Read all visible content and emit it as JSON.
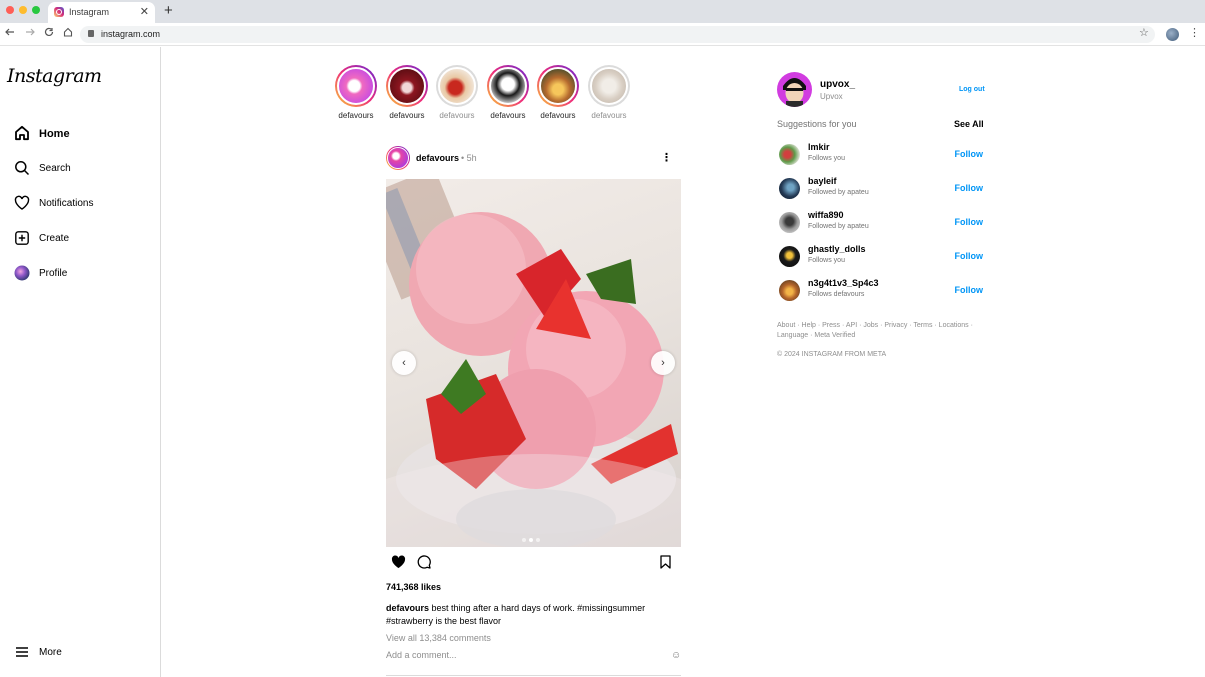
{
  "browser": {
    "tab_title": "Instagram",
    "tab_close": "✕",
    "new_tab": "+",
    "url": "instagram.com",
    "icons": [
      "back-icon",
      "forward-icon",
      "reload-icon",
      "home-icon",
      "lock-icon",
      "star-icon",
      "profile-avatar",
      "menu-icon"
    ]
  },
  "sidebar": {
    "logo": "Instagram",
    "items": [
      {
        "label": "Home",
        "icon": "home-icon",
        "active": true
      },
      {
        "label": "Search",
        "icon": "search-icon"
      },
      {
        "label": "Notifications",
        "icon": "heart-icon"
      },
      {
        "label": "Create",
        "icon": "plus-square-icon"
      },
      {
        "label": "Profile",
        "icon": "profile-avatar"
      }
    ],
    "more_label": "More"
  },
  "stories": [
    {
      "name": "defavours",
      "seen": false
    },
    {
      "name": "defavours",
      "seen": false
    },
    {
      "name": "defavours",
      "seen": true
    },
    {
      "name": "defavours",
      "seen": false
    },
    {
      "name": "defavours",
      "seen": false
    },
    {
      "name": "defavours",
      "seen": true
    }
  ],
  "post": {
    "username": "defavours",
    "time": "• 5h",
    "more": "⋮",
    "carousel_index": 2,
    "carousel_count": 3,
    "likes": "741,368 likes",
    "caption_user": "defavours",
    "caption_text": "best thing after a hard days of work. #missingsummer #strawberry is the best flavor",
    "view_comments": "View all 13,384 comments",
    "add_comment_placeholder": "Add a comment...",
    "liked": true
  },
  "me": {
    "username": "upvox_",
    "name": "Upvox",
    "logout": "Log out"
  },
  "suggestions": {
    "title": "Suggestions for you",
    "see_all": "See All",
    "follow_label": "Follow",
    "items": [
      {
        "username": "lmkir",
        "sub": "Follows you"
      },
      {
        "username": "bayleif",
        "sub": "Followed by apateu"
      },
      {
        "username": "wiffa890",
        "sub": "Followed by apateu"
      },
      {
        "username": "ghastly_dolls",
        "sub": "Follows you"
      },
      {
        "username": "n3g4t1v3_Sp4c3",
        "sub": "Follows defavours"
      }
    ]
  },
  "footer": {
    "links": "About · Help · Press · API · Jobs · Privacy · Terms · Locations · Language · Meta Verified",
    "copyright": "© 2024 INSTAGRAM FROM META"
  },
  "colors": {
    "accent": "#0095f6",
    "story_gradient": [
      "#f9ce34",
      "#ee2a7b",
      "#6228d7"
    ],
    "heart": "#000000"
  }
}
